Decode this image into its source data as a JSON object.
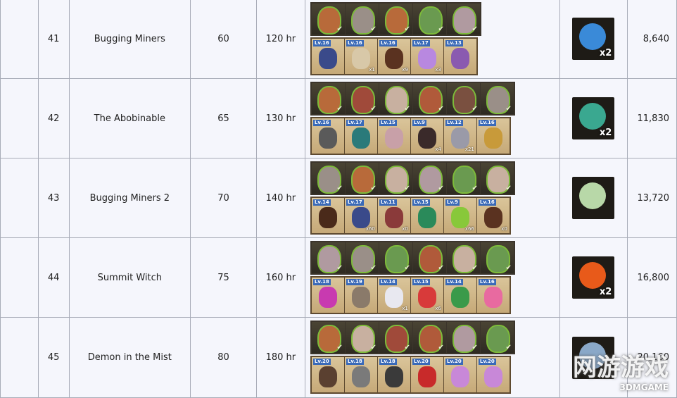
{
  "missions": [
    {
      "num": "41",
      "name": "Bugging Miners",
      "level": "60",
      "duration": "120 hr",
      "value": "8,640",
      "heroes": [
        "hero-ranger",
        "hero-knight",
        "hero-ranger",
        "hero-elf",
        "hero-paladin"
      ],
      "hero_colors": [
        "#b86a3a",
        "#9a8f88",
        "#b86a3a",
        "#6a9a50",
        "#b09aa0"
      ],
      "items": [
        {
          "lv": "Lv.16",
          "icon": "gauntlet-icon",
          "color": "#3a4a8a",
          "qty": ""
        },
        {
          "lv": "Lv.16",
          "icon": "golem-icon",
          "color": "#d8c8a8",
          "qty": "x1"
        },
        {
          "lv": "Lv.16",
          "icon": "boots-icon",
          "color": "#5a3220",
          "qty": "x9"
        },
        {
          "lv": "Lv.17",
          "icon": "potion-icon",
          "color": "#b888e0",
          "qty": "x3"
        },
        {
          "lv": "Lv.13",
          "icon": "robe-icon",
          "color": "#8a5ab0",
          "qty": ""
        }
      ],
      "reward": {
        "icon": "moon-charm-icon",
        "color": "#3a8ad8",
        "mult": "x2"
      }
    },
    {
      "num": "42",
      "name": "The Abobinable",
      "level": "65",
      "duration": "130 hr",
      "value": "11,830",
      "heroes": [
        "hero-ranger",
        "hero-cavalier",
        "hero-furhat",
        "hero-rogue",
        "hero-elf",
        "hero-knight"
      ],
      "hero_colors": [
        "#b86a3a",
        "#a04a3a",
        "#c8b0a0",
        "#b05a3a",
        "#7a5040",
        "#9a8f88"
      ],
      "items": [
        {
          "lv": "Lv.16",
          "icon": "mace-icon",
          "color": "#5a5a5a",
          "qty": ""
        },
        {
          "lv": "Lv.17",
          "icon": "armor-icon",
          "color": "#2a7a7a",
          "qty": ""
        },
        {
          "lv": "Lv.15",
          "icon": "fur-boots-icon",
          "color": "#c8a0a8",
          "qty": ""
        },
        {
          "lv": "Lv.9",
          "icon": "bomb-icon",
          "color": "#3a2a2a",
          "qty": "x4"
        },
        {
          "lv": "Lv.12",
          "icon": "dagger-icon",
          "color": "#9a9aa8",
          "qty": "x21"
        },
        {
          "lv": "Lv.16",
          "icon": "bow-icon",
          "color": "#c89a3a",
          "qty": ""
        }
      ],
      "reward": {
        "icon": "elixir-icon",
        "color": "#3aa890",
        "mult": "x2"
      }
    },
    {
      "num": "43",
      "name": "Bugging Miners 2",
      "level": "70",
      "duration": "140 hr",
      "value": "13,720",
      "heroes": [
        "hero-knight",
        "hero-ranger",
        "hero-furhat",
        "hero-paladin",
        "hero-elf",
        "hero-furhat"
      ],
      "hero_colors": [
        "#9a8f88",
        "#b86a3a",
        "#c8b0a0",
        "#b09aa0",
        "#6a9a50",
        "#c8b0a0"
      ],
      "items": [
        {
          "lv": "Lv.14",
          "icon": "boots-icon",
          "color": "#4a2a1a",
          "qty": ""
        },
        {
          "lv": "Lv.17",
          "icon": "pistol-icon",
          "color": "#3a4a8a",
          "qty": "x60"
        },
        {
          "lv": "Lv.11",
          "icon": "crossbow-icon",
          "color": "#8a3a3a",
          "qty": "x0"
        },
        {
          "lv": "Lv.15",
          "icon": "cloak-icon",
          "color": "#2a8a5a",
          "qty": ""
        },
        {
          "lv": "Lv.9",
          "icon": "flask-icon",
          "color": "#88c83a",
          "qty": "x66"
        },
        {
          "lv": "Lv.16",
          "icon": "boots-icon",
          "color": "#5a3220",
          "qty": "x0"
        }
      ],
      "reward": {
        "icon": "star-scroll-icon",
        "color": "#b8d8a8",
        "mult": ""
      }
    },
    {
      "num": "44",
      "name": "Summit Witch",
      "level": "75",
      "duration": "160 hr",
      "value": "16,800",
      "heroes": [
        "hero-paladin",
        "hero-knight",
        "hero-elf",
        "hero-rogue",
        "hero-furhat",
        "hero-elf"
      ],
      "hero_colors": [
        "#b09aa0",
        "#9a8f88",
        "#6a9a50",
        "#b05a3a",
        "#c8b0a0",
        "#6a9a50"
      ],
      "items": [
        {
          "lv": "Lv.18",
          "icon": "orb-staff-icon",
          "color": "#c83ab0",
          "qty": ""
        },
        {
          "lv": "Lv.19",
          "icon": "beast-icon",
          "color": "#8a7a6a",
          "qty": ""
        },
        {
          "lv": "Lv.14",
          "icon": "skull-icon",
          "color": "#e8e8f0",
          "qty": "x1"
        },
        {
          "lv": "Lv.15",
          "icon": "red-flask-icon",
          "color": "#d83a3a",
          "qty": "x6"
        },
        {
          "lv": "Lv.14",
          "icon": "green-blade-icon",
          "color": "#3a9a4a",
          "qty": ""
        },
        {
          "lv": "Lv.16",
          "icon": "wand-icon",
          "color": "#e86aa0",
          "qty": ""
        }
      ],
      "reward": {
        "icon": "fire-gem-icon",
        "color": "#e85a1a",
        "mult": "x2"
      }
    },
    {
      "num": "45",
      "name": "Demon in the Mist",
      "level": "80",
      "duration": "180 hr",
      "value": "20,160",
      "heroes": [
        "hero-ranger",
        "hero-furhat",
        "hero-cavalier",
        "hero-rogue",
        "hero-paladin",
        "hero-elf"
      ],
      "hero_colors": [
        "#b86a3a",
        "#c8b0a0",
        "#a04a3a",
        "#b05a3a",
        "#b09aa0",
        "#6a9a50"
      ],
      "items": [
        {
          "lv": "Lv.20",
          "icon": "musket-icon",
          "color": "#5a4030",
          "qty": ""
        },
        {
          "lv": "Lv.18",
          "icon": "crossbow-icon",
          "color": "#7a7a7a",
          "qty": ""
        },
        {
          "lv": "Lv.18",
          "icon": "morningstar-icon",
          "color": "#3a3a3a",
          "qty": ""
        },
        {
          "lv": "Lv.20",
          "icon": "red-armor-icon",
          "color": "#c82a2a",
          "qty": ""
        },
        {
          "lv": "Lv.20",
          "icon": "feather-icon",
          "color": "#c888d8",
          "qty": ""
        },
        {
          "lv": "Lv.20",
          "icon": "feather-icon",
          "color": "#c888d8",
          "qty": ""
        }
      ],
      "reward": {
        "icon": "gear-icon",
        "color": "#8aa8c8",
        "mult": ""
      }
    }
  ],
  "watermark": {
    "main": "网游游戏",
    "sub": "3DMGAME"
  }
}
